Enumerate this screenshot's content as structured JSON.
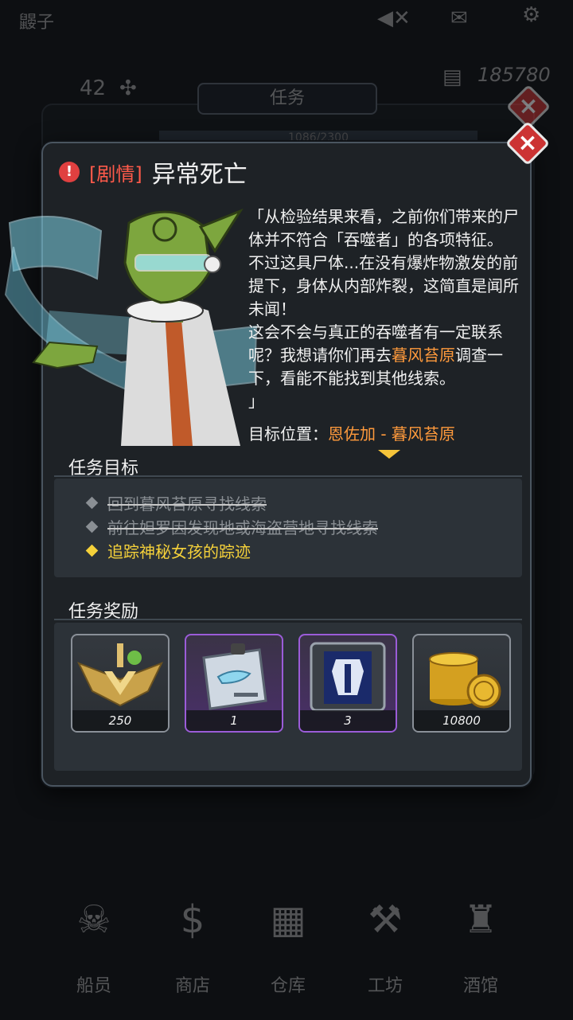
{
  "background": {
    "player_name": "鼹子",
    "level": "42",
    "gold": "185780",
    "tab_title": "任务",
    "progress_text": "1086/2300",
    "nav": [
      {
        "label": "船员",
        "icon": "crew-icon"
      },
      {
        "label": "商店",
        "icon": "shop-icon"
      },
      {
        "label": "仓库",
        "icon": "warehouse-icon"
      },
      {
        "label": "工坊",
        "icon": "workshop-icon"
      },
      {
        "label": "酒馆",
        "icon": "tavern-icon"
      }
    ]
  },
  "dialog": {
    "tag": "[剧情]",
    "title": "异常死亡",
    "story_part1": "「从检验结果来看，之前你们带来的尸体并不符合「吞噬者」的各项特征。\n不过这具尸体...在没有爆炸物激发的前提下，身体从内部炸裂，这简直是闻所未闻！\n这会不会与真正的吞噬者有一定联系呢？我想请你们再去",
    "story_highlight": "暮风苔原",
    "story_part2": "调查一下，看能不能找到其他线索。\n」",
    "target_label": "目标位置：",
    "target_location": "恩佐加 - 暮风苔原",
    "objectives_title": "任务目标",
    "objectives": [
      {
        "text": "回到暮风苔原寻找线索",
        "status": "done"
      },
      {
        "text": "前往妲罗因发现地或海盗营地寻找线索",
        "status": "done"
      },
      {
        "text": "追踪神秘女孩的踪迹",
        "status": "active"
      }
    ],
    "rewards_title": "任务奖励",
    "rewards": [
      {
        "name": "badge-reward",
        "count": "250",
        "rarity": "normal"
      },
      {
        "name": "blueprint-reward",
        "count": "1",
        "rarity": "epic"
      },
      {
        "name": "armor-crate-reward",
        "count": "3",
        "rarity": "epic"
      },
      {
        "name": "gold-coins-reward",
        "count": "10800",
        "rarity": "normal"
      }
    ]
  },
  "colors": {
    "tag": "#ff5a4a",
    "highlight": "#ff9a3c",
    "active_objective": "#f5d13a",
    "epic_border": "#9b5cd8"
  }
}
